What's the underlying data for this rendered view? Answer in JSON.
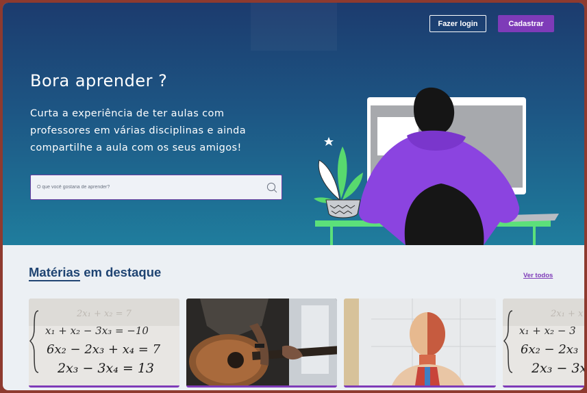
{
  "header": {
    "login_label": "Fazer login",
    "signup_label": "Cadastrar"
  },
  "hero": {
    "title": "Bora aprender ?",
    "subtitle": "Curta a experiência de ter aulas com professores em várias disciplinas e ainda compartilhe a aula com os seus amigos!",
    "search_placeholder": "O que você gostaria de aprender?"
  },
  "featured": {
    "title_highlight": "Matérias",
    "title_rest": " em destaque",
    "see_all_label": "Ver todos",
    "cards": [
      {
        "name": "math-card",
        "image": "equations-image"
      },
      {
        "name": "music-card",
        "image": "guitar-image"
      },
      {
        "name": "biology-card",
        "image": "anatomy-model-image"
      },
      {
        "name": "math-card-2",
        "image": "equations-image"
      }
    ]
  },
  "colors": {
    "accent": "#7e3bb8",
    "heading": "#1f4472",
    "hero_top": "#1c3b6e",
    "hero_bottom": "#1f7d9d",
    "frame": "#8e3a2f"
  }
}
